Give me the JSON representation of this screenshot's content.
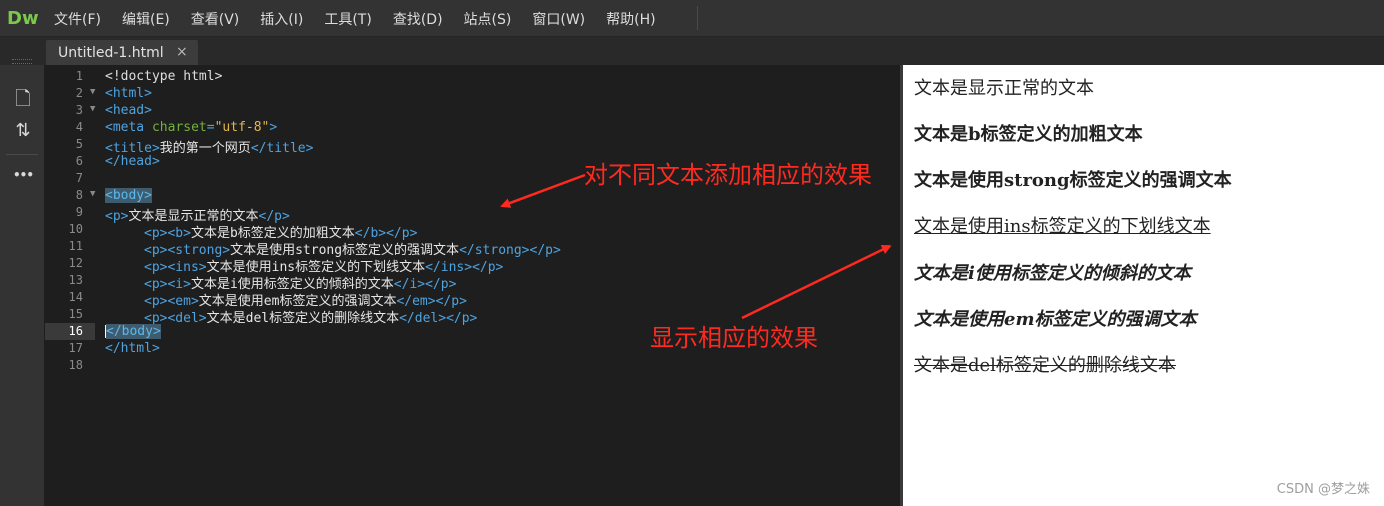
{
  "app": {
    "logo": "Dw"
  },
  "menu": [
    "文件(F)",
    "编辑(E)",
    "查看(V)",
    "插入(I)",
    "工具(T)",
    "查找(D)",
    "站点(S)",
    "窗口(W)",
    "帮助(H)"
  ],
  "tab": {
    "title": "Untitled-1.html",
    "close": "×"
  },
  "toolbar": {
    "file_icon": "🗋",
    "sort_icon": "⇅",
    "more_icon": "•••"
  },
  "editor": {
    "active_line": 16,
    "lines": [
      {
        "n": "1",
        "fold": "",
        "indent": "",
        "parts": [
          [
            "dk",
            "<!doctype html>"
          ]
        ]
      },
      {
        "n": "2",
        "fold": "▼",
        "indent": "",
        "parts": [
          [
            "tg",
            "<html>"
          ]
        ]
      },
      {
        "n": "3",
        "fold": "▼",
        "indent": "",
        "parts": [
          [
            "tg",
            "<head>"
          ]
        ]
      },
      {
        "n": "4",
        "fold": "",
        "indent": "",
        "parts": [
          [
            "tg",
            "<meta "
          ],
          [
            "at",
            "charset"
          ],
          [
            "tg",
            "="
          ],
          [
            "st",
            "\"utf-8\""
          ],
          [
            "tg",
            ">"
          ]
        ]
      },
      {
        "n": "5",
        "fold": "",
        "indent": "",
        "parts": [
          [
            "tg",
            "<title>"
          ],
          [
            "tx",
            "我的第一个网页"
          ],
          [
            "tg",
            "</title>"
          ]
        ]
      },
      {
        "n": "6",
        "fold": "",
        "indent": "",
        "parts": [
          [
            "tg",
            "</head>"
          ]
        ]
      },
      {
        "n": "7",
        "fold": "",
        "indent": "",
        "parts": []
      },
      {
        "n": "8",
        "fold": "▼",
        "indent": "",
        "parts": [
          [
            "hl",
            "<body>"
          ]
        ]
      },
      {
        "n": "9",
        "fold": "",
        "indent": "",
        "parts": [
          [
            "tg",
            "<p>"
          ],
          [
            "tx",
            "文本是显示正常的文本"
          ],
          [
            "tg",
            "</p>"
          ]
        ]
      },
      {
        "n": "10",
        "fold": "",
        "indent": "     ",
        "parts": [
          [
            "tg",
            "<p><b>"
          ],
          [
            "tx",
            "文本是b标签定义的加粗文本"
          ],
          [
            "tg",
            "</b></p>"
          ]
        ]
      },
      {
        "n": "11",
        "fold": "",
        "indent": "     ",
        "parts": [
          [
            "tg",
            "<p><strong>"
          ],
          [
            "tx",
            "文本是使用strong标签定义的强调文本"
          ],
          [
            "tg",
            "</strong></p>"
          ]
        ]
      },
      {
        "n": "12",
        "fold": "",
        "indent": "     ",
        "parts": [
          [
            "tg",
            "<p><ins>"
          ],
          [
            "tx",
            "文本是使用ins标签定义的下划线文本"
          ],
          [
            "tg",
            "</ins></p>"
          ]
        ]
      },
      {
        "n": "13",
        "fold": "",
        "indent": "     ",
        "parts": [
          [
            "tg",
            "<p><i>"
          ],
          [
            "tx",
            "文本是i使用标签定义的倾斜的文本"
          ],
          [
            "tg",
            "</i></p>"
          ]
        ]
      },
      {
        "n": "14",
        "fold": "",
        "indent": "     ",
        "parts": [
          [
            "tg",
            "<p><em>"
          ],
          [
            "tx",
            "文本是使用em标签定义的强调文本"
          ],
          [
            "tg",
            "</em></p>"
          ]
        ]
      },
      {
        "n": "15",
        "fold": "",
        "indent": "     ",
        "parts": [
          [
            "tg",
            "<p><del>"
          ],
          [
            "tx",
            "文本是del标签定义的删除线文本"
          ],
          [
            "tg",
            "</del></p>"
          ]
        ]
      },
      {
        "n": "16",
        "fold": "",
        "indent": "",
        "parts": [
          [
            "caret",
            ""
          ],
          [
            "hl",
            "</body>"
          ]
        ]
      },
      {
        "n": "17",
        "fold": "",
        "indent": "",
        "parts": [
          [
            "tg",
            "</html>"
          ]
        ]
      },
      {
        "n": "18",
        "fold": "",
        "indent": "",
        "parts": []
      }
    ]
  },
  "annotations": {
    "top": "对不同文本添加相应的效果",
    "bottom": "显示相应的效果",
    "color": "#ff2a1f"
  },
  "preview": {
    "normal": "文本是显示正常的文本",
    "bold": "文本是b标签定义的加粗文本",
    "strong": "文本是使用strong标签定义的强调文本",
    "ins": "文本是使用ins标签定义的下划线文本",
    "italic": "文本是i使用标签定义的倾斜的文本",
    "em": "文本是使用em标签定义的强调文本",
    "del": "文本是del标签定义的删除线文本"
  },
  "watermark": "CSDN @梦之姝"
}
